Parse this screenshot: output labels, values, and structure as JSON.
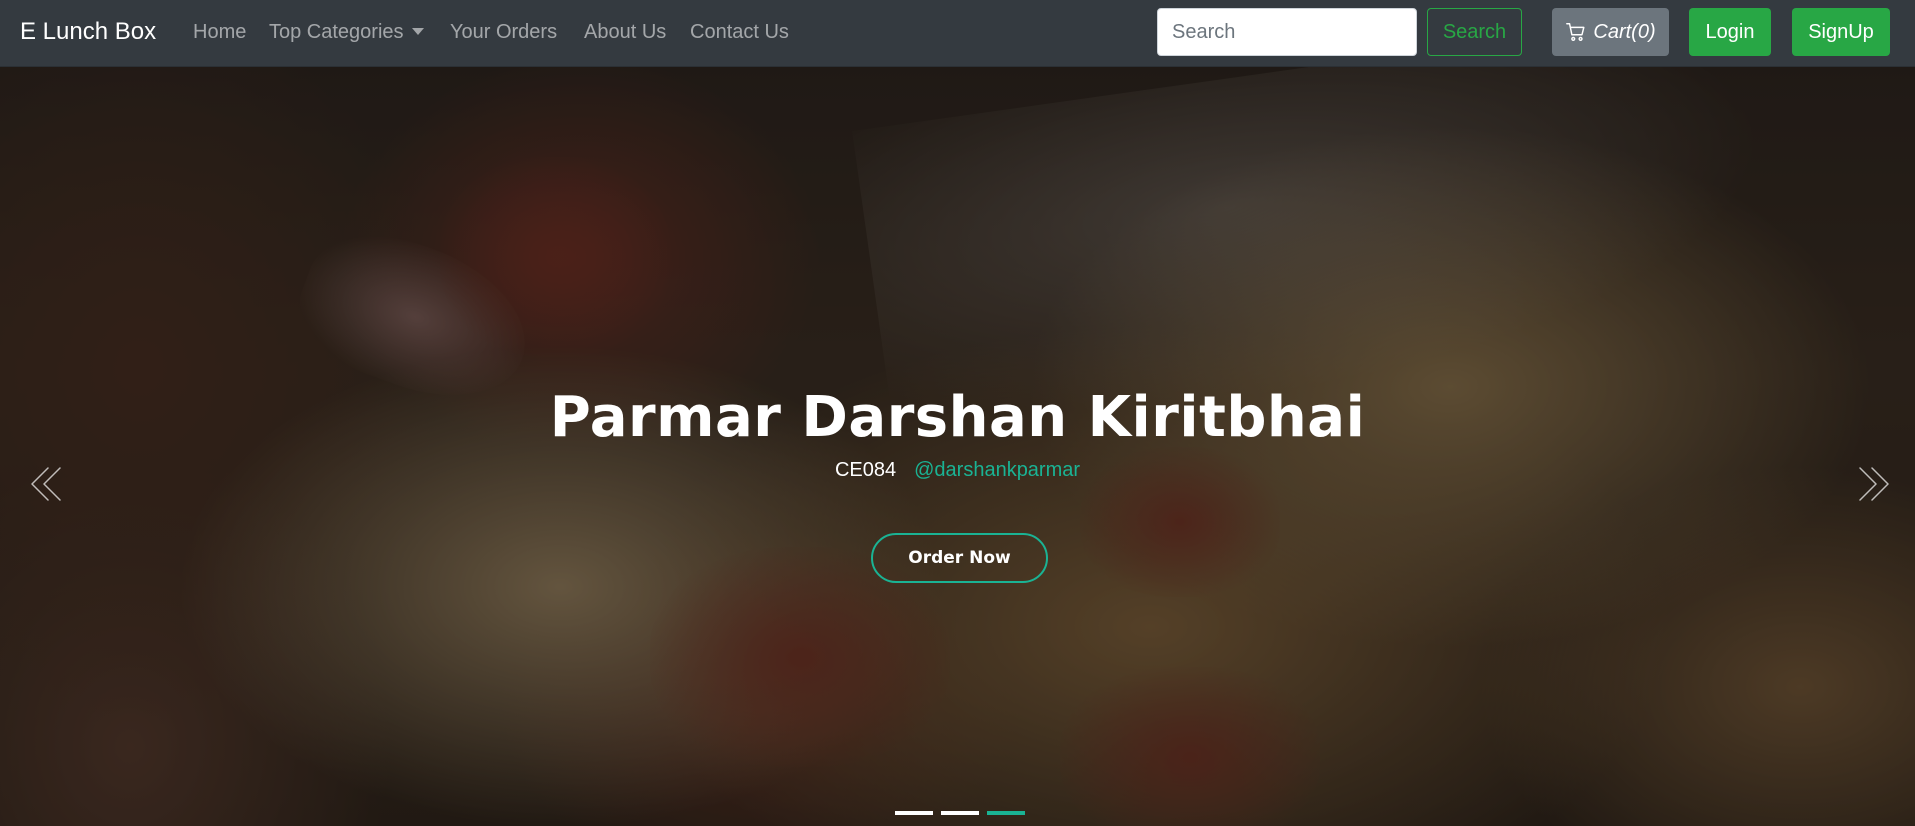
{
  "navbar": {
    "brand": "E Lunch Box",
    "links": {
      "home": "Home",
      "categories": "Top Categories",
      "orders": "Your Orders",
      "about": "About Us",
      "contact": "Contact Us"
    },
    "search": {
      "placeholder": "Search",
      "button_label": "Search"
    },
    "cart_label": "Cart(0)",
    "login_label": "Login",
    "signup_label": "SignUp",
    "colors": {
      "navbar_bg": "#343a40",
      "success": "#28a745",
      "secondary": "#6c757d"
    }
  },
  "hero": {
    "title": "Parmar Darshan Kiritbhai",
    "code": "CE084",
    "handle": "@darshankparmar",
    "button_label": "Order Now",
    "accent_color": "#1ab394",
    "slides_count": 3,
    "active_slide": 3,
    "icons": {
      "prev": "chevron-double-left-icon",
      "next": "chevron-double-right-icon",
      "cart": "cart-icon"
    }
  }
}
